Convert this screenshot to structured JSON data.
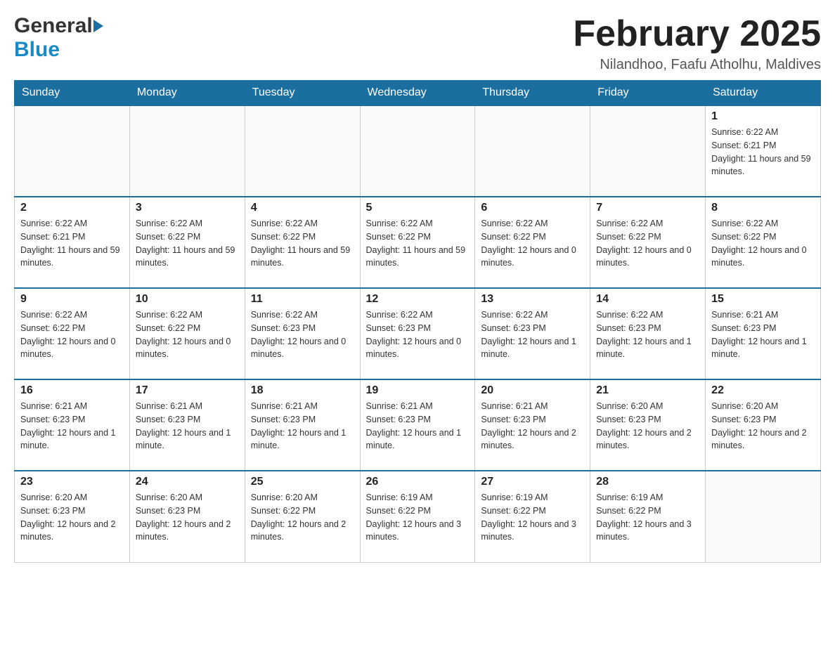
{
  "header": {
    "logo_general": "General",
    "logo_blue": "Blue",
    "month_title": "February 2025",
    "location": "Nilandhoo, Faafu Atholhu, Maldives"
  },
  "days_of_week": [
    "Sunday",
    "Monday",
    "Tuesday",
    "Wednesday",
    "Thursday",
    "Friday",
    "Saturday"
  ],
  "weeks": [
    [
      {
        "day": "",
        "sunrise": "",
        "sunset": "",
        "daylight": ""
      },
      {
        "day": "",
        "sunrise": "",
        "sunset": "",
        "daylight": ""
      },
      {
        "day": "",
        "sunrise": "",
        "sunset": "",
        "daylight": ""
      },
      {
        "day": "",
        "sunrise": "",
        "sunset": "",
        "daylight": ""
      },
      {
        "day": "",
        "sunrise": "",
        "sunset": "",
        "daylight": ""
      },
      {
        "day": "",
        "sunrise": "",
        "sunset": "",
        "daylight": ""
      },
      {
        "day": "1",
        "sunrise": "Sunrise: 6:22 AM",
        "sunset": "Sunset: 6:21 PM",
        "daylight": "Daylight: 11 hours and 59 minutes."
      }
    ],
    [
      {
        "day": "2",
        "sunrise": "Sunrise: 6:22 AM",
        "sunset": "Sunset: 6:21 PM",
        "daylight": "Daylight: 11 hours and 59 minutes."
      },
      {
        "day": "3",
        "sunrise": "Sunrise: 6:22 AM",
        "sunset": "Sunset: 6:22 PM",
        "daylight": "Daylight: 11 hours and 59 minutes."
      },
      {
        "day": "4",
        "sunrise": "Sunrise: 6:22 AM",
        "sunset": "Sunset: 6:22 PM",
        "daylight": "Daylight: 11 hours and 59 minutes."
      },
      {
        "day": "5",
        "sunrise": "Sunrise: 6:22 AM",
        "sunset": "Sunset: 6:22 PM",
        "daylight": "Daylight: 11 hours and 59 minutes."
      },
      {
        "day": "6",
        "sunrise": "Sunrise: 6:22 AM",
        "sunset": "Sunset: 6:22 PM",
        "daylight": "Daylight: 12 hours and 0 minutes."
      },
      {
        "day": "7",
        "sunrise": "Sunrise: 6:22 AM",
        "sunset": "Sunset: 6:22 PM",
        "daylight": "Daylight: 12 hours and 0 minutes."
      },
      {
        "day": "8",
        "sunrise": "Sunrise: 6:22 AM",
        "sunset": "Sunset: 6:22 PM",
        "daylight": "Daylight: 12 hours and 0 minutes."
      }
    ],
    [
      {
        "day": "9",
        "sunrise": "Sunrise: 6:22 AM",
        "sunset": "Sunset: 6:22 PM",
        "daylight": "Daylight: 12 hours and 0 minutes."
      },
      {
        "day": "10",
        "sunrise": "Sunrise: 6:22 AM",
        "sunset": "Sunset: 6:22 PM",
        "daylight": "Daylight: 12 hours and 0 minutes."
      },
      {
        "day": "11",
        "sunrise": "Sunrise: 6:22 AM",
        "sunset": "Sunset: 6:23 PM",
        "daylight": "Daylight: 12 hours and 0 minutes."
      },
      {
        "day": "12",
        "sunrise": "Sunrise: 6:22 AM",
        "sunset": "Sunset: 6:23 PM",
        "daylight": "Daylight: 12 hours and 0 minutes."
      },
      {
        "day": "13",
        "sunrise": "Sunrise: 6:22 AM",
        "sunset": "Sunset: 6:23 PM",
        "daylight": "Daylight: 12 hours and 1 minute."
      },
      {
        "day": "14",
        "sunrise": "Sunrise: 6:22 AM",
        "sunset": "Sunset: 6:23 PM",
        "daylight": "Daylight: 12 hours and 1 minute."
      },
      {
        "day": "15",
        "sunrise": "Sunrise: 6:21 AM",
        "sunset": "Sunset: 6:23 PM",
        "daylight": "Daylight: 12 hours and 1 minute."
      }
    ],
    [
      {
        "day": "16",
        "sunrise": "Sunrise: 6:21 AM",
        "sunset": "Sunset: 6:23 PM",
        "daylight": "Daylight: 12 hours and 1 minute."
      },
      {
        "day": "17",
        "sunrise": "Sunrise: 6:21 AM",
        "sunset": "Sunset: 6:23 PM",
        "daylight": "Daylight: 12 hours and 1 minute."
      },
      {
        "day": "18",
        "sunrise": "Sunrise: 6:21 AM",
        "sunset": "Sunset: 6:23 PM",
        "daylight": "Daylight: 12 hours and 1 minute."
      },
      {
        "day": "19",
        "sunrise": "Sunrise: 6:21 AM",
        "sunset": "Sunset: 6:23 PM",
        "daylight": "Daylight: 12 hours and 1 minute."
      },
      {
        "day": "20",
        "sunrise": "Sunrise: 6:21 AM",
        "sunset": "Sunset: 6:23 PM",
        "daylight": "Daylight: 12 hours and 2 minutes."
      },
      {
        "day": "21",
        "sunrise": "Sunrise: 6:20 AM",
        "sunset": "Sunset: 6:23 PM",
        "daylight": "Daylight: 12 hours and 2 minutes."
      },
      {
        "day": "22",
        "sunrise": "Sunrise: 6:20 AM",
        "sunset": "Sunset: 6:23 PM",
        "daylight": "Daylight: 12 hours and 2 minutes."
      }
    ],
    [
      {
        "day": "23",
        "sunrise": "Sunrise: 6:20 AM",
        "sunset": "Sunset: 6:23 PM",
        "daylight": "Daylight: 12 hours and 2 minutes."
      },
      {
        "day": "24",
        "sunrise": "Sunrise: 6:20 AM",
        "sunset": "Sunset: 6:23 PM",
        "daylight": "Daylight: 12 hours and 2 minutes."
      },
      {
        "day": "25",
        "sunrise": "Sunrise: 6:20 AM",
        "sunset": "Sunset: 6:22 PM",
        "daylight": "Daylight: 12 hours and 2 minutes."
      },
      {
        "day": "26",
        "sunrise": "Sunrise: 6:19 AM",
        "sunset": "Sunset: 6:22 PM",
        "daylight": "Daylight: 12 hours and 3 minutes."
      },
      {
        "day": "27",
        "sunrise": "Sunrise: 6:19 AM",
        "sunset": "Sunset: 6:22 PM",
        "daylight": "Daylight: 12 hours and 3 minutes."
      },
      {
        "day": "28",
        "sunrise": "Sunrise: 6:19 AM",
        "sunset": "Sunset: 6:22 PM",
        "daylight": "Daylight: 12 hours and 3 minutes."
      },
      {
        "day": "",
        "sunrise": "",
        "sunset": "",
        "daylight": ""
      }
    ]
  ]
}
